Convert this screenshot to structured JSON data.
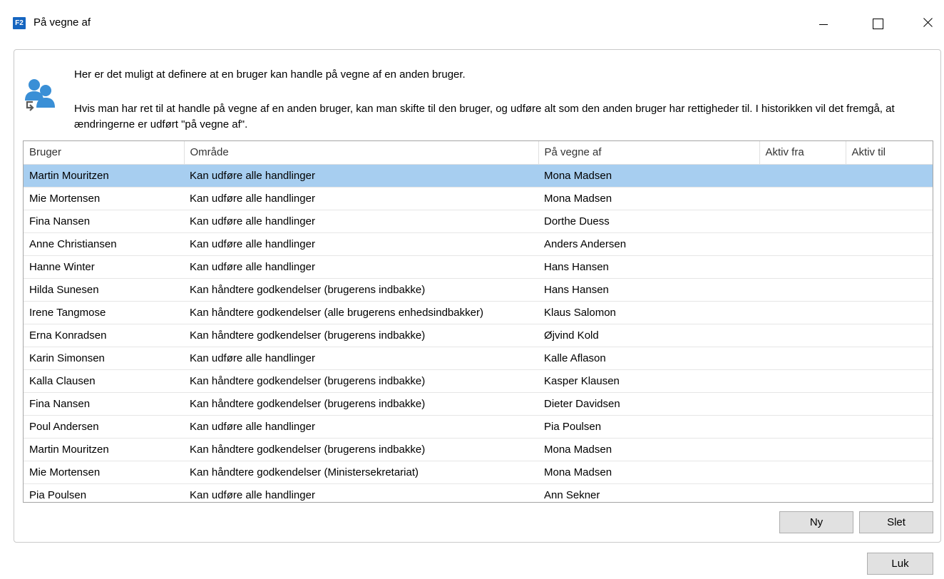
{
  "window": {
    "app_badge": "F2",
    "title": "På vegne af"
  },
  "info": {
    "line1": "Her er det muligt at definere at en bruger kan handle på vegne af en anden bruger.",
    "line2": "Hvis man har ret til at handle på vegne af en anden bruger, kan man skifte til den bruger, og udføre alt som den anden bruger har rettigheder til. I historikken vil det fremgå, at ændringerne er udført \"på vegne af\"."
  },
  "grid": {
    "columns": [
      "Bruger",
      "Område",
      "På vegne af",
      "Aktiv fra",
      "Aktiv til"
    ],
    "selected_row": 0,
    "rows": [
      {
        "bruger": "Martin Mouritzen",
        "omraade": "Kan udføre alle handlinger",
        "paa_vegne_af": "Mona Madsen",
        "aktiv_fra": "",
        "aktiv_til": ""
      },
      {
        "bruger": "Mie Mortensen",
        "omraade": "Kan udføre alle handlinger",
        "paa_vegne_af": "Mona Madsen",
        "aktiv_fra": "",
        "aktiv_til": ""
      },
      {
        "bruger": "Fina Nansen",
        "omraade": "Kan udføre alle handlinger",
        "paa_vegne_af": "Dorthe Duess",
        "aktiv_fra": "",
        "aktiv_til": ""
      },
      {
        "bruger": "Anne Christiansen",
        "omraade": "Kan udføre alle handlinger",
        "paa_vegne_af": "Anders Andersen",
        "aktiv_fra": "",
        "aktiv_til": ""
      },
      {
        "bruger": "Hanne Winter",
        "omraade": "Kan udføre alle handlinger",
        "paa_vegne_af": "Hans Hansen",
        "aktiv_fra": "",
        "aktiv_til": ""
      },
      {
        "bruger": "Hilda Sunesen",
        "omraade": "Kan håndtere godkendelser (brugerens indbakke)",
        "paa_vegne_af": "Hans Hansen",
        "aktiv_fra": "",
        "aktiv_til": ""
      },
      {
        "bruger": "Irene Tangmose",
        "omraade": "Kan håndtere godkendelser (alle brugerens enhedsindbakker)",
        "paa_vegne_af": "Klaus Salomon",
        "aktiv_fra": "",
        "aktiv_til": ""
      },
      {
        "bruger": "Erna Konradsen",
        "omraade": "Kan håndtere godkendelser (brugerens indbakke)",
        "paa_vegne_af": "Øjvind Kold",
        "aktiv_fra": "",
        "aktiv_til": ""
      },
      {
        "bruger": "Karin Simonsen",
        "omraade": "Kan udføre alle handlinger",
        "paa_vegne_af": "Kalle Aflason",
        "aktiv_fra": "",
        "aktiv_til": ""
      },
      {
        "bruger": "Kalla Clausen",
        "omraade": "Kan håndtere godkendelser (brugerens indbakke)",
        "paa_vegne_af": "Kasper Klausen",
        "aktiv_fra": "",
        "aktiv_til": ""
      },
      {
        "bruger": "Fina Nansen",
        "omraade": "Kan håndtere godkendelser (brugerens indbakke)",
        "paa_vegne_af": "Dieter Davidsen",
        "aktiv_fra": "",
        "aktiv_til": ""
      },
      {
        "bruger": "Poul Andersen",
        "omraade": "Kan udføre alle handlinger",
        "paa_vegne_af": "Pia Poulsen",
        "aktiv_fra": "",
        "aktiv_til": ""
      },
      {
        "bruger": "Martin Mouritzen",
        "omraade": "Kan håndtere godkendelser (brugerens indbakke)",
        "paa_vegne_af": "Mona Madsen",
        "aktiv_fra": "",
        "aktiv_til": ""
      },
      {
        "bruger": "Mie Mortensen",
        "omraade": "Kan håndtere godkendelser (Ministersekretariat)",
        "paa_vegne_af": "Mona Madsen",
        "aktiv_fra": "",
        "aktiv_til": ""
      },
      {
        "bruger": "Pia Poulsen",
        "omraade": "Kan udføre alle handlinger",
        "paa_vegne_af": "Ann Sekner",
        "aktiv_fra": "",
        "aktiv_til": ""
      }
    ]
  },
  "buttons": {
    "new": "Ny",
    "delete": "Slet",
    "close": "Luk"
  },
  "colors": {
    "accent": "#1565c0",
    "selection": "#a7cef0",
    "icon_blue": "#3a8fd6"
  },
  "icons": {
    "app": "f2-app-icon",
    "info": "users-switch-icon"
  }
}
